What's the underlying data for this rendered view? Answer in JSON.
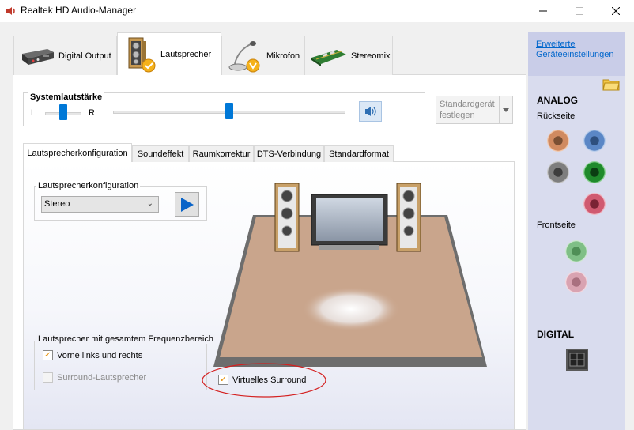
{
  "window": {
    "title": "Realtek HD Audio-Manager",
    "min_icon": "minimize-icon",
    "max_icon": "maximize-icon",
    "close_icon": "close-icon"
  },
  "device_tabs": [
    {
      "label": "Digital Output",
      "icon": "digital-output-icon",
      "active": false
    },
    {
      "label": "Lautsprecher",
      "icon": "speaker-icon",
      "active": true
    },
    {
      "label": "Mikrofon",
      "icon": "microphone-icon",
      "active": false
    },
    {
      "label": "Stereomix",
      "icon": "stereomix-card-icon",
      "active": false
    }
  ],
  "volume": {
    "title": "Systemlautstärke",
    "left_label": "L",
    "right_label": "R",
    "balance_fraction": 0.5,
    "level_fraction": 0.5,
    "mute_icon": "speaker-volume-icon"
  },
  "default_device": {
    "line1": "Standardgerät",
    "line2": "festlegen"
  },
  "sub_tabs": [
    {
      "label": "Lautsprecherkonfiguration",
      "active": true
    },
    {
      "label": "Soundeffekt",
      "active": false
    },
    {
      "label": "Raumkorrektur",
      "active": false
    },
    {
      "label": "DTS-Verbindung",
      "active": false
    },
    {
      "label": "Standardformat",
      "active": false
    }
  ],
  "speaker_config": {
    "group_title": "Lautsprecherkonfiguration",
    "selected": "Stereo",
    "play_icon": "play-icon"
  },
  "full_range": {
    "group_title": "Lautsprecher mit gesamtem Frequenzbereich",
    "front": {
      "label": "Vorne links und rechts",
      "checked": true,
      "enabled": true
    },
    "surround": {
      "label": "Surround-Lautsprecher",
      "checked": false,
      "enabled": false
    }
  },
  "virtual_surround": {
    "label": "Virtuelles Surround",
    "checked": true
  },
  "side": {
    "advanced_link_line1": "Erweiterte",
    "advanced_link_line2": "Geräteeinstellungen",
    "analog_label": "ANALOG",
    "rear_label": "Rückseite",
    "front_label": "Frontseite",
    "digital_label": "DIGITAL",
    "jack_colors": {
      "orange": "#d08a60",
      "blue": "#5b87c6",
      "gray": "#7e7e7e",
      "green": "#1f8a2b",
      "pink": "#d05a70",
      "front_green": "#7fbf86",
      "front_pink": "#d9a3b1"
    }
  },
  "colors": {
    "accent": "#0078d7",
    "annotation_red": "#d42020",
    "room_floor": "#c9a58c"
  }
}
